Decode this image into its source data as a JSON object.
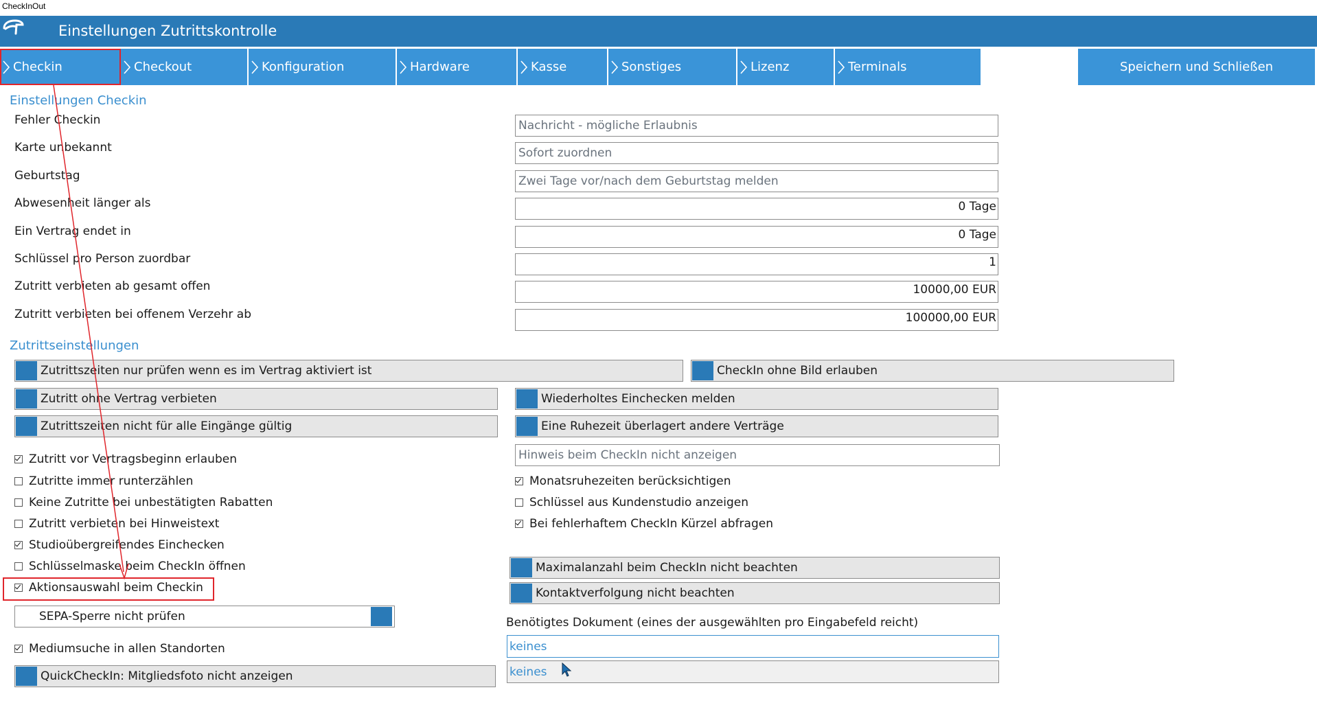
{
  "window_title": "CheckInOut",
  "app_title": "Einstellungen Zutrittskontrolle",
  "colors": {
    "header": "#2a7ab7",
    "tab": "#3a94d8",
    "accent": "#3a8fcf",
    "annotation": "#e0252b"
  },
  "icons": {
    "logo": "app-logo-icon",
    "tab_chevron": "chevron-right-icon"
  },
  "tabs": [
    {
      "label": "Checkin",
      "selected": true
    },
    {
      "label": "Checkout"
    },
    {
      "label": "Konfiguration"
    },
    {
      "label": "Hardware"
    },
    {
      "label": "Kasse"
    },
    {
      "label": "Sonstiges"
    },
    {
      "label": "Lizenz"
    },
    {
      "label": "Terminals"
    }
  ],
  "save_button": "Speichern und Schließen",
  "section_checkin": {
    "title": "Einstellungen Checkin",
    "rows": [
      {
        "label": "Fehler Checkin",
        "value": "Nachricht - mögliche Erlaubnis"
      },
      {
        "label": "Karte unbekannt",
        "value": "Sofort zuordnen"
      },
      {
        "label": "Geburtstag",
        "value": "Zwei Tage vor/nach dem Geburtstag melden"
      },
      {
        "label": "Abwesenheit länger als",
        "value": "0 Tage"
      },
      {
        "label": "Ein Vertrag endet in",
        "value": "0 Tage"
      },
      {
        "label": "Schlüssel pro Person zuordbar",
        "value": "1"
      },
      {
        "label": "Zutritt verbieten ab gesamt offen",
        "value": "10000,00 EUR"
      },
      {
        "label": "Zutritt verbieten bei offenem Verzehr ab",
        "value": "100000,00 EUR"
      }
    ]
  },
  "section_access": {
    "title": "Zutrittseinstellungen",
    "toggles": {
      "t1": "Zutrittszeiten nur prüfen wenn es im Vertrag aktiviert ist",
      "t2": "CheckIn ohne Bild erlauben",
      "t3": "Zutritt ohne Vertrag verbieten",
      "t4": "Wiederholtes Einchecken melden",
      "t5": "Zutrittszeiten nicht für alle Eingänge gültig",
      "t6": "Eine Ruhezeit überlagert andere Verträge",
      "t7": "Maximalanzahl beim CheckIn nicht  beachten",
      "t8": "Kontaktverfolgung nicht beachten",
      "t9": "SEPA-Sperre nicht prüfen",
      "t10": "QuickCheckIn: Mitgliedsfoto nicht anzeigen"
    },
    "hint_field": "Hinweis beim CheckIn nicht anzeigen",
    "left_checkboxes": [
      {
        "label": "Zutritt vor Vertragsbeginn erlauben",
        "checked": true
      },
      {
        "label": "Zutritte immer runterzählen",
        "checked": false
      },
      {
        "label": "Keine Zutritte bei unbestätigten Rabatten",
        "checked": false
      },
      {
        "label": "Zutritt verbieten bei Hinweistext",
        "checked": false
      },
      {
        "label": "Studioübergreifendes Einchecken",
        "checked": true
      },
      {
        "label": "Schlüsselmaske beim CheckIn öffnen",
        "checked": false
      },
      {
        "label": "Aktionsauswahl beim Checkin",
        "checked": true
      }
    ],
    "medium_checkbox": {
      "label": "Mediumsuche in allen Standorten",
      "checked": true
    },
    "right_checkboxes": [
      {
        "label": "Monatsruhezeiten berücksichtigen",
        "checked": true
      },
      {
        "label": "Schlüssel aus Kundenstudio anzeigen",
        "checked": false
      },
      {
        "label": "Bei fehlerhaftem CheckIn Kürzel abfragen",
        "checked": true
      }
    ],
    "doc_label": "Benötigtes Dokument (eines der ausgewählten pro Eingabefeld reicht)",
    "doc_fields": [
      "keines",
      "keines"
    ]
  }
}
